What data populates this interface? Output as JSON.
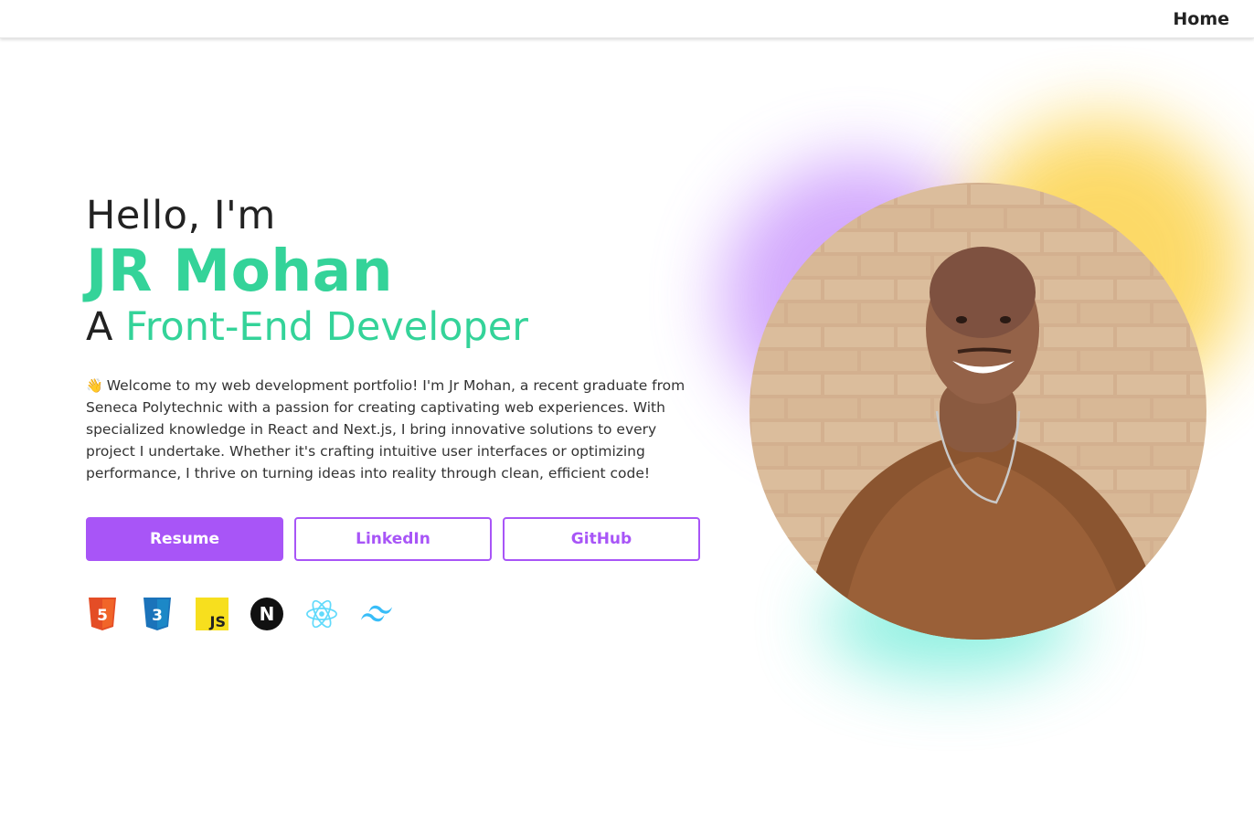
{
  "nav": {
    "home_label": "Home"
  },
  "hero": {
    "greeting": "Hello, I'm",
    "name": "JR Mohan",
    "role_prefix": "A",
    "role": "Front-End Developer",
    "wave_emoji": "👋",
    "intro": "Welcome to my web development portfolio! I'm Jr Mohan, a recent graduate from Seneca Polytechnic with a passion for creating captivating web experiences. With specialized knowledge in React and Next.js, I bring innovative solutions to every project I undertake. Whether it's crafting intuitive user interfaces or optimizing performance, I thrive on turning ideas into reality through clean, efficient code!"
  },
  "buttons": {
    "resume": "Resume",
    "linkedin": "LinkedIn",
    "github": "GitHub"
  },
  "tech_icons": [
    {
      "name": "html5-icon",
      "label": "5",
      "color": "#e44d26"
    },
    {
      "name": "css3-icon",
      "label": "3",
      "color": "#1b73ba"
    },
    {
      "name": "javascript-icon",
      "label": "JS",
      "color": "#f7df1e"
    },
    {
      "name": "nextjs-icon",
      "label": "N",
      "color": "#111111"
    },
    {
      "name": "react-icon",
      "label": "",
      "color": "#61dafb"
    },
    {
      "name": "tailwind-icon",
      "label": "",
      "color": "#38bdf8"
    }
  ],
  "colors": {
    "accent_green": "#34d399",
    "accent_purple": "#a855f7",
    "glow_purple": "#c084fc",
    "glow_yellow": "#fcd34d",
    "glow_teal": "#5eead4"
  }
}
